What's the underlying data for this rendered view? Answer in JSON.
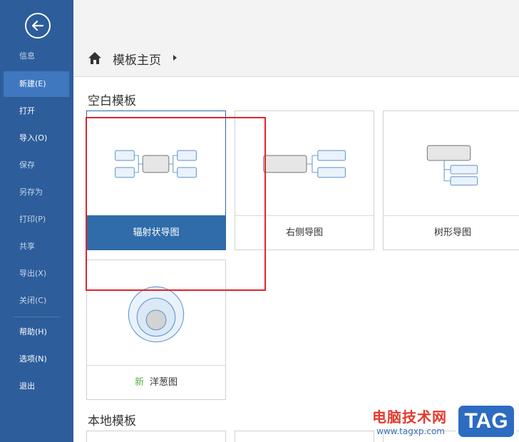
{
  "sidebar": {
    "items": [
      {
        "label": "信息",
        "state": "dim"
      },
      {
        "label": "新建(E)",
        "state": "active"
      },
      {
        "label": "打开",
        "state": "normal"
      },
      {
        "label": "导入(O)",
        "state": "normal"
      },
      {
        "label": "保存",
        "state": "dim"
      },
      {
        "label": "另存为",
        "state": "dim"
      },
      {
        "label": "打印(P)",
        "state": "dim"
      },
      {
        "label": "共享",
        "state": "dim"
      },
      {
        "label": "导出(X)",
        "state": "dim"
      },
      {
        "label": "关闭(C)",
        "state": "dim"
      },
      {
        "label": "帮助(H)",
        "state": "normal"
      },
      {
        "label": "选项(N)",
        "state": "normal"
      },
      {
        "label": "退出",
        "state": "normal"
      }
    ]
  },
  "breadcrumb": {
    "home_icon": "home-icon",
    "label": "模板主页"
  },
  "sections": {
    "blank_title": "空白模板",
    "local_title": "本地模板"
  },
  "templates": [
    {
      "name": "辐射状导图",
      "selected": true
    },
    {
      "name": "右侧导图",
      "selected": false
    },
    {
      "name": "树形导图",
      "selected": false
    },
    {
      "name": "洋葱图",
      "tag": "新",
      "selected": false
    }
  ],
  "watermark": {
    "text": "电脑技术网",
    "url": "www.tagxp.com",
    "badge": "TAG"
  },
  "colors": {
    "sidebar": "#2d5d9b",
    "active": "#3f78bf",
    "selected_label": "#2f6ca9",
    "highlight_box": "#e0242c",
    "new_tag": "#5bb14a"
  }
}
